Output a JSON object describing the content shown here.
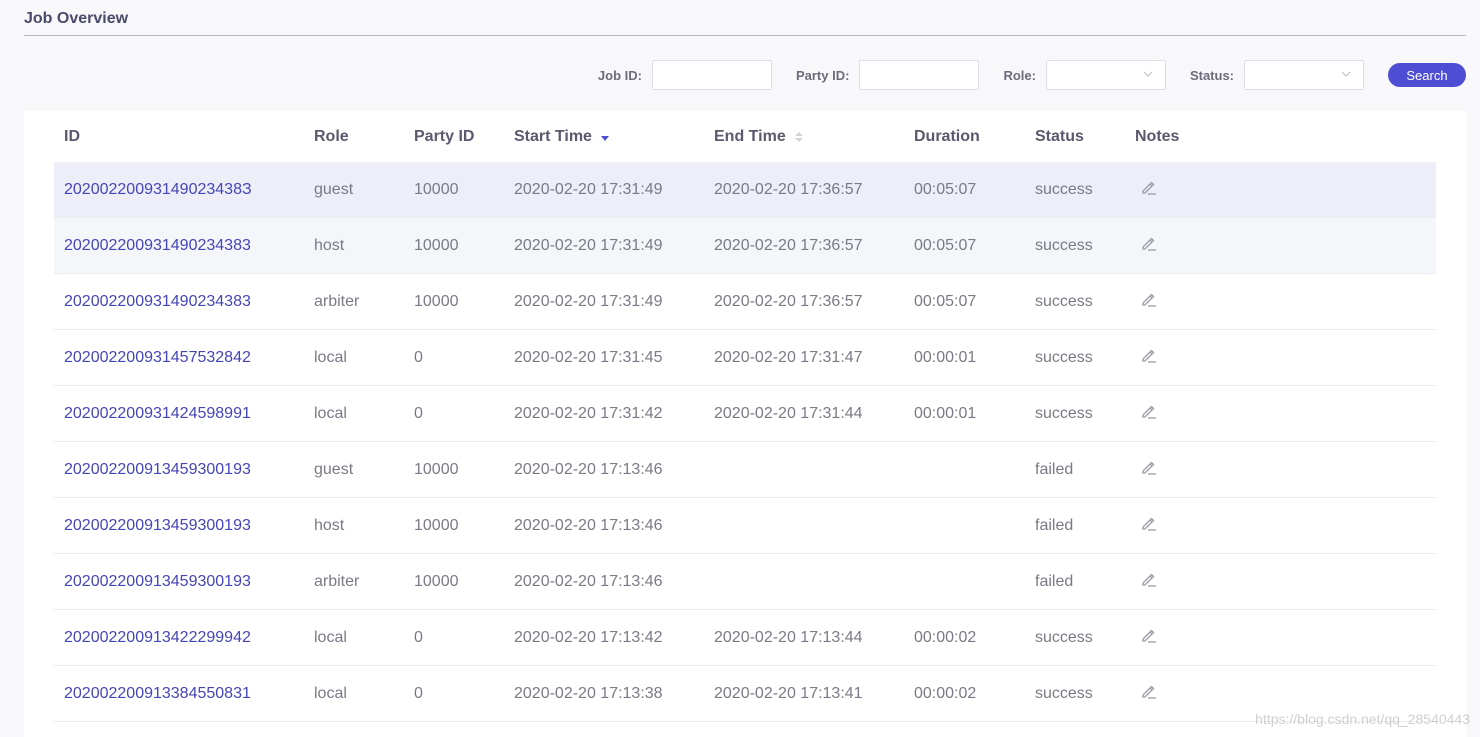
{
  "page": {
    "title": "Job Overview"
  },
  "filters": {
    "job_id_label": "Job ID:",
    "job_id_value": "",
    "party_id_label": "Party ID:",
    "party_id_value": "",
    "role_label": "Role:",
    "role_value": "",
    "status_label": "Status:",
    "status_value": "",
    "search_label": "Search"
  },
  "table": {
    "columns": {
      "id": "ID",
      "role": "Role",
      "party_id": "Party ID",
      "start_time": "Start Time",
      "end_time": "End Time",
      "duration": "Duration",
      "status": "Status",
      "notes": "Notes"
    },
    "sort": {
      "column": "start_time",
      "direction": "descending"
    },
    "rows": [
      {
        "id": "20200220093149023438З",
        "role": "guest",
        "party_id": "10000",
        "start_time": "2020-02-20 17:31:49",
        "end_time": "2020-02-20 17:36:57",
        "duration": "00:05:07",
        "status": "success"
      },
      {
        "id": "202002200931490234383",
        "role": "host",
        "party_id": "10000",
        "start_time": "2020-02-20 17:31:49",
        "end_time": "2020-02-20 17:36:57",
        "duration": "00:05:07",
        "status": "success"
      },
      {
        "id": "202002200931490234383",
        "role": "arbiter",
        "party_id": "10000",
        "start_time": "2020-02-20 17:31:49",
        "end_time": "2020-02-20 17:36:57",
        "duration": "00:05:07",
        "status": "success"
      },
      {
        "id": "202002200931457532842",
        "role": "local",
        "party_id": "0",
        "start_time": "2020-02-20 17:31:45",
        "end_time": "2020-02-20 17:31:47",
        "duration": "00:00:01",
        "status": "success"
      },
      {
        "id": "202002200931424598991",
        "role": "local",
        "party_id": "0",
        "start_time": "2020-02-20 17:31:42",
        "end_time": "2020-02-20 17:31:44",
        "duration": "00:00:01",
        "status": "success"
      },
      {
        "id": "202002200913459300193",
        "role": "guest",
        "party_id": "10000",
        "start_time": "2020-02-20 17:13:46",
        "end_time": "",
        "duration": "",
        "status": "failed"
      },
      {
        "id": "202002200913459300193",
        "role": "host",
        "party_id": "10000",
        "start_time": "2020-02-20 17:13:46",
        "end_time": "",
        "duration": "",
        "status": "failed"
      },
      {
        "id": "202002200913459300193",
        "role": "arbiter",
        "party_id": "10000",
        "start_time": "2020-02-20 17:13:46",
        "end_time": "",
        "duration": "",
        "status": "failed"
      },
      {
        "id": "202002200913422299942",
        "role": "local",
        "party_id": "0",
        "start_time": "2020-02-20 17:13:42",
        "end_time": "2020-02-20 17:13:44",
        "duration": "00:00:02",
        "status": "success"
      },
      {
        "id": "202002200913384550831",
        "role": "local",
        "party_id": "0",
        "start_time": "2020-02-20 17:13:38",
        "end_time": "2020-02-20 17:13:41",
        "duration": "00:00:02",
        "status": "success"
      }
    ]
  },
  "watermark": "https://blog.csdn.net/qq_28540443",
  "colors": {
    "accent": "#4e4ed4",
    "link": "#4545b8",
    "highlight_row": "#eeeef8"
  },
  "icons": {
    "notes": "edit-icon",
    "select": "chevron-down-icon",
    "sort_active": "sort-descending-icon",
    "sort_inactive": "sort-icon"
  }
}
